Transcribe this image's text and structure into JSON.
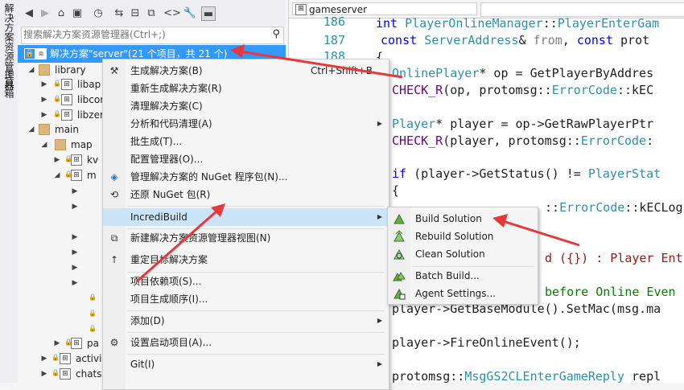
{
  "side_tabs": [
    "解决方案资源管理器",
    "工具箱"
  ],
  "se_toolbar": {
    "icons": [
      "back-icon",
      "forward-icon",
      "home-icon",
      "switch-view-icon",
      "history-icon",
      "sync-icon",
      "collapse-all-icon",
      "show-all-files-icon",
      "code-view-icon",
      "properties-icon",
      "preview-icon"
    ]
  },
  "se_search": {
    "placeholder": "搜索解决方案资源管理器(Ctrl+;)"
  },
  "tree": {
    "solution": "解决方案\"server\"(21 个项目，共 21 个)",
    "items": [
      {
        "label": "library"
      },
      {
        "label": "libap"
      },
      {
        "label": "libcor"
      },
      {
        "label": "libzer"
      },
      {
        "label": "main"
      },
      {
        "label": "map"
      },
      {
        "label": "kv"
      },
      {
        "label": "m"
      },
      {
        "label": "pa"
      },
      {
        "label": "activi"
      },
      {
        "label": "chats"
      }
    ]
  },
  "editor": {
    "nav_file": "gameserver",
    "line_numbers": [
      "186",
      "187",
      "188"
    ]
  },
  "context_menu": {
    "items": [
      {
        "label": "生成解决方案(B)",
        "shortcut": "Ctrl+Shift+B"
      },
      {
        "label": "重新生成解决方案(R)"
      },
      {
        "label": "清理解决方案(C)"
      },
      {
        "label": "分析和代码清理(A)"
      },
      {
        "label": "批生成(T)..."
      },
      {
        "label": "配置管理器(O)..."
      },
      {
        "label": "管理解决方案的 NuGet 程序包(N)..."
      },
      {
        "label": "还原 NuGet 包(R)"
      },
      {
        "label": "IncrediBuild"
      },
      {
        "label": "新建解决方案资源管理器视图(N)"
      },
      {
        "label": "重定目标解决方案"
      },
      {
        "label": "项目依赖项(S)..."
      },
      {
        "label": "项目生成顺序(I)..."
      },
      {
        "label": "添加(D)"
      },
      {
        "label": "设置启动项目(A)..."
      },
      {
        "label": "Git(I)"
      }
    ]
  },
  "submenu": {
    "items": [
      {
        "label": "Build Solution"
      },
      {
        "label": "Rebuild Solution"
      },
      {
        "label": "Clean Solution"
      },
      {
        "label": "Batch Build..."
      },
      {
        "label": "Agent Settings..."
      }
    ]
  },
  "colors": {
    "selection": "#3399ff",
    "menu_highlight": "#cce4f7",
    "annotation_arrow": "#e8393a"
  }
}
